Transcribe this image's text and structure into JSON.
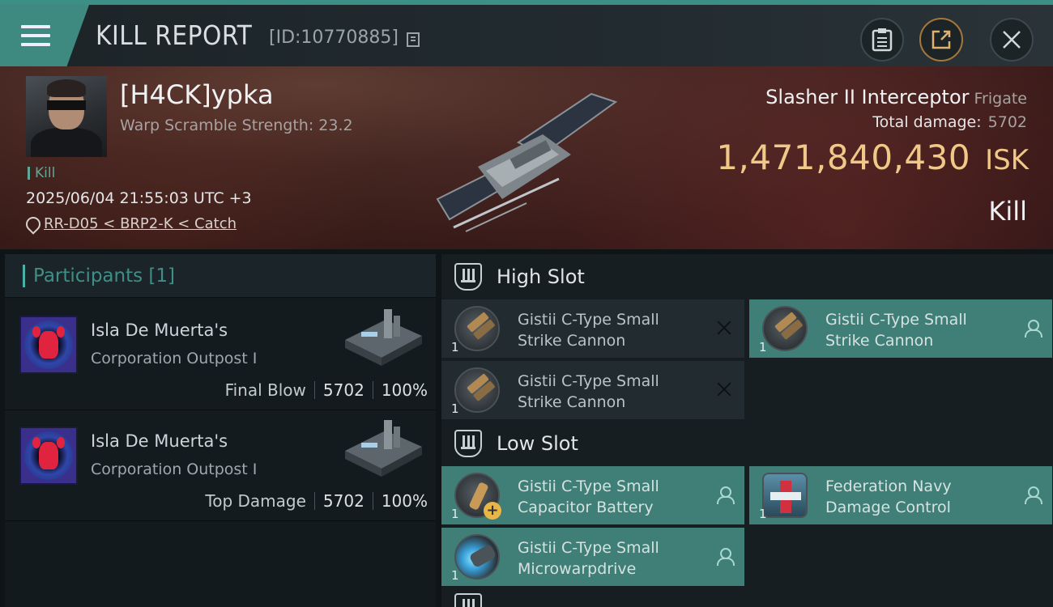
{
  "header": {
    "title": "KILL REPORT",
    "report_id": "[ID:10770885]",
    "menu_icon": "hamburger-menu-icon",
    "buttons": [
      "clipboard-icon",
      "share-icon",
      "close-icon"
    ]
  },
  "victim": {
    "name": "[H4CK]ypka",
    "warp_scramble": "Warp Scramble Strength: 23.2",
    "kill_tag": "Kill",
    "datetime": "2025/06/04 21:55:03 UTC +3",
    "location": "RR-D05 < BRP2-K < Catch",
    "ship_name": "Slasher II Interceptor",
    "ship_class": "Frigate",
    "damage_label": "Total damage:",
    "damage_value": "5702",
    "isk_value": "1,471,840,430",
    "isk_unit": "ISK",
    "status": "Kill"
  },
  "participants": {
    "title": "Participants [1]",
    "rows": [
      {
        "name": "Isla De Muerta's",
        "type": "Corporation Outpost I",
        "role": "Final Blow",
        "damage": "5702",
        "percent": "100%"
      },
      {
        "name": "Isla De Muerta's",
        "type": "Corporation Outpost I",
        "role": "Top Damage",
        "damage": "5702",
        "percent": "100%"
      }
    ]
  },
  "fitting": {
    "high_slot_title": "High Slot",
    "low_slot_title": "Low Slot",
    "high_modules": [
      {
        "line1": "Gistii C-Type Small",
        "line2": "Strike Cannon",
        "qty": "1",
        "status": "destroyed"
      },
      {
        "line1": "Gistii C-Type Small",
        "line2": "Strike Cannon",
        "qty": "1",
        "status": "dropped"
      },
      {
        "line1": "Gistii C-Type Small",
        "line2": "Strike Cannon",
        "qty": "1",
        "status": "destroyed"
      }
    ],
    "low_modules": [
      {
        "line1": "Gistii C-Type Small",
        "line2": "Capacitor Battery",
        "qty": "1",
        "status": "dropped"
      },
      {
        "line1": "Federation Navy",
        "line2": "Damage Control",
        "qty": "1",
        "status": "dropped"
      },
      {
        "line1": "Gistii C-Type Small",
        "line2": "Microwarpdrive",
        "qty": "1",
        "status": "dropped"
      }
    ]
  },
  "colors": {
    "accent": "#3e8a80",
    "isk_gold": "#f0c888",
    "fitted_module": "#3f7f77"
  }
}
